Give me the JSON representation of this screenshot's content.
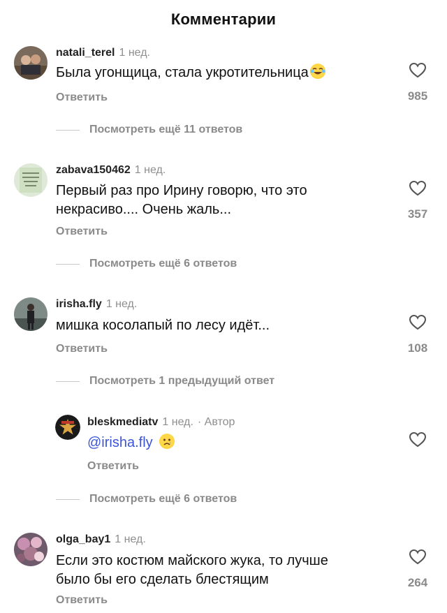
{
  "header": {
    "title": "Комментарии"
  },
  "comments": [
    {
      "user": "natali_terel",
      "time": "1 нед.",
      "text_lines": [
        "Была угонщица, стала укротительница"
      ],
      "emoji": "laughing-tears-emoji",
      "reply_label": "Ответить",
      "likes": "985",
      "more_label": "Посмотреть ещё 11 ответов"
    },
    {
      "user": "zabava150462",
      "time": "1 нед.",
      "text_lines": [
        "Первый раз про Ирину говорю, что это",
        "некрасиво.... Очень жаль..."
      ],
      "reply_label": "Ответить",
      "likes": "357",
      "more_label": "Посмотреть ещё 6 ответов"
    },
    {
      "user": "irisha.fly",
      "time": "1 нед.",
      "text_lines": [
        "мишка косолапый по лесу идёт..."
      ],
      "reply_label": "Ответить",
      "likes": "108",
      "more_label": "Посмотреть 1 предыдущий ответ"
    },
    {
      "user": "bleskmediatv",
      "time": "1 нед.",
      "author_badge": "· Автор",
      "mention": "@irisha.fly",
      "emoji": "crying-face-emoji",
      "reply_label": "Ответить",
      "more_label": "Посмотреть ещё 6 ответов"
    },
    {
      "user": "olga_bay1",
      "time": "1 нед.",
      "text_lines": [
        "Если это костюм майского жука, то лучше",
        "было бы его сделать блестящим"
      ],
      "reply_label": "Ответить",
      "likes": "264"
    }
  ],
  "colors": {
    "muted": "#8a8a8a",
    "mention": "#3b55d9",
    "line": "#c9c9c9"
  }
}
